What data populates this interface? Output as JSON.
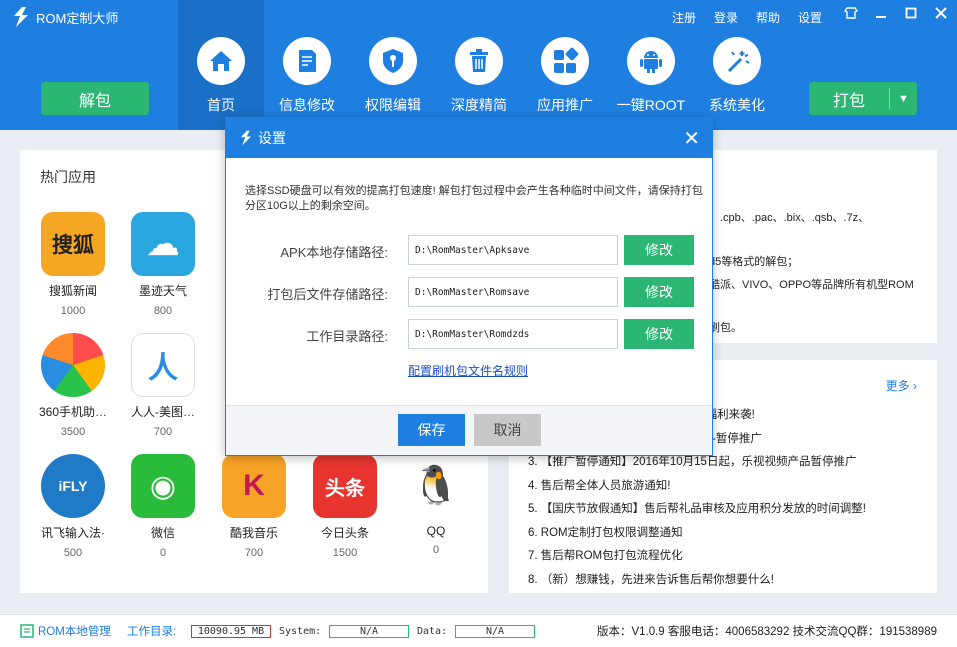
{
  "app": {
    "title": "ROM定制大师"
  },
  "top_links": [
    "注册",
    "登录",
    "帮助",
    "设置"
  ],
  "buttons": {
    "unpack": "解包",
    "pack": "打包"
  },
  "nav": [
    {
      "label": "首页",
      "icon": "home-icon"
    },
    {
      "label": "信息修改",
      "icon": "document-edit-icon"
    },
    {
      "label": "权限编辑",
      "icon": "key-shield-icon"
    },
    {
      "label": "深度精简",
      "icon": "trash-icon"
    },
    {
      "label": "应用推广",
      "icon": "apps-grid-icon"
    },
    {
      "label": "一键ROOT",
      "icon": "android-icon"
    },
    {
      "label": "系统美化",
      "icon": "magic-wand-icon"
    }
  ],
  "hot_apps": {
    "title": "热门应用",
    "items": [
      {
        "name": "搜狐新闻",
        "count": "1000",
        "glyph": "搜狐",
        "color": "#f5a623"
      },
      {
        "name": "墨迹天气",
        "count": "800",
        "glyph": "☁",
        "color": "#2aa6e0"
      },
      {
        "name": "360手机助…",
        "count": "3500",
        "glyph": "",
        "color": "#ff8a2b"
      },
      {
        "name": "人人-美图…",
        "count": "700",
        "glyph": "人",
        "color": "#2a8ee0"
      },
      {
        "name": "讯飞输入法·",
        "count": "500",
        "glyph": "iFLY",
        "color": "#1f7ac8"
      },
      {
        "name": "微信",
        "count": "0",
        "glyph": "◉",
        "color": "#2bbb3a"
      },
      {
        "name": "酷我音乐",
        "count": "700",
        "glyph": "K",
        "color": "#f7a325"
      },
      {
        "name": "今日头条",
        "count": "1500",
        "glyph": "头条",
        "color": "#e8342f"
      },
      {
        "name": "QQ",
        "count": "0",
        "glyph": "🐧",
        "color": "#ffffff"
      }
    ]
  },
  "support_panel": {
    "lines": [
      "、.cpb、.pac、.bix、.qsb、.7z、",
      "d5等格式的解包；",
      "酷派、VIVO、OPPO等品牌所有机型ROM",
      "刷包。"
    ]
  },
  "news": {
    "more": "更多",
    "items": [
      "1. 【喜讯】ROM定制大师，一大波福利来袭!",
      "2. 【推广暂停通知】2016年10月9日-暂停推广",
      "3. 【推广暂停通知】2016年10月15日起，乐视视频产品暂停推广",
      "4. 售后帮全体人员旅游通知!",
      "5. 【国庆节放假通知】售后帮礼品审核及应用积分发放的时间调整!",
      "6. ROM定制打包权限调整通知",
      "7. 售后帮ROM包打包流程优化",
      "8. （新）想赚钱，先进来告诉售后帮你想要什么!"
    ]
  },
  "status": {
    "manager": "ROM本地管理",
    "workdir_label": "工作目录:",
    "workdir_value": "10090.95 MB",
    "system_label": "System:",
    "system_value": "N/A",
    "data_label": "Data:",
    "data_value": "N/A",
    "right_text": "版本：V1.0.9  客服电话：4006583292  技术交流QQ群：191538989"
  },
  "dialog": {
    "title": "设置",
    "description": "选择SSD硬盘可以有效的提高打包速度! 解包打包过程中会产生各种临时中间文件，请保持打包分区10G以上的剩余空间。",
    "rows": [
      {
        "label": "APK本地存储路径:",
        "value": "D:\\RomMaster\\Apksave",
        "button": "修改"
      },
      {
        "label": "打包后文件存储路径:",
        "value": "D:\\RomMaster\\Romsave",
        "button": "修改"
      },
      {
        "label": "工作目录路径:",
        "value": "D:\\RomMaster\\Romdzds",
        "button": "修改"
      }
    ],
    "rules_link": "配置刷机包文件名规则",
    "save": "保存",
    "cancel": "取消"
  },
  "colors": {
    "primary": "#1e7fe0",
    "green": "#2bb673"
  }
}
